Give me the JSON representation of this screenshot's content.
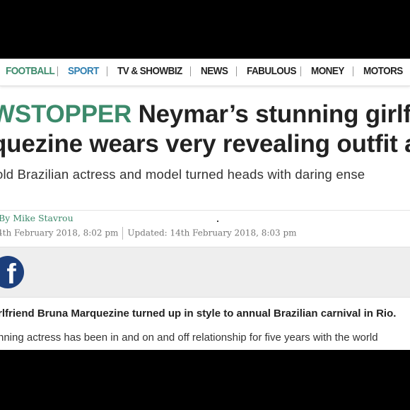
{
  "nav": {
    "items": [
      {
        "label": "FOOTBALL",
        "color": "#3c8a6b"
      },
      {
        "label": "SPORT",
        "color": "#2f7fb0"
      },
      {
        "label": "TV & SHOWBIZ",
        "color": "#222222"
      },
      {
        "label": "NEWS",
        "color": "#222222"
      },
      {
        "label": "FABULOUS",
        "color": "#222222"
      },
      {
        "label": "MONEY",
        "color": "#222222"
      },
      {
        "label": "MOTORS",
        "color": "#222222"
      }
    ]
  },
  "article": {
    "kicker": "WSTOPPER",
    "headline_line1": "Neymar’s stunning girlfri",
    "headline_line2": "quezine wears very revealing outfit at",
    "subheadline": "old Brazilian actress and model turned heads with daring ense",
    "byline": "By Mike Stavrou",
    "published": "4th February 2018, 8:02 pm",
    "updated": "Updated: 14th February 2018, 8:03 pm",
    "share_icon": "facebook-icon",
    "share_letter": "f",
    "lead": "rlfriend Bruna Marquezine turned up in style to annual Brazilian carnival in Rio.",
    "body": "nning actress has been in and on and off relationship for five years with the world"
  },
  "colors": {
    "accent": "#3c8a6b",
    "sport": "#2f7fb0",
    "facebook": "#1c3f7c"
  }
}
